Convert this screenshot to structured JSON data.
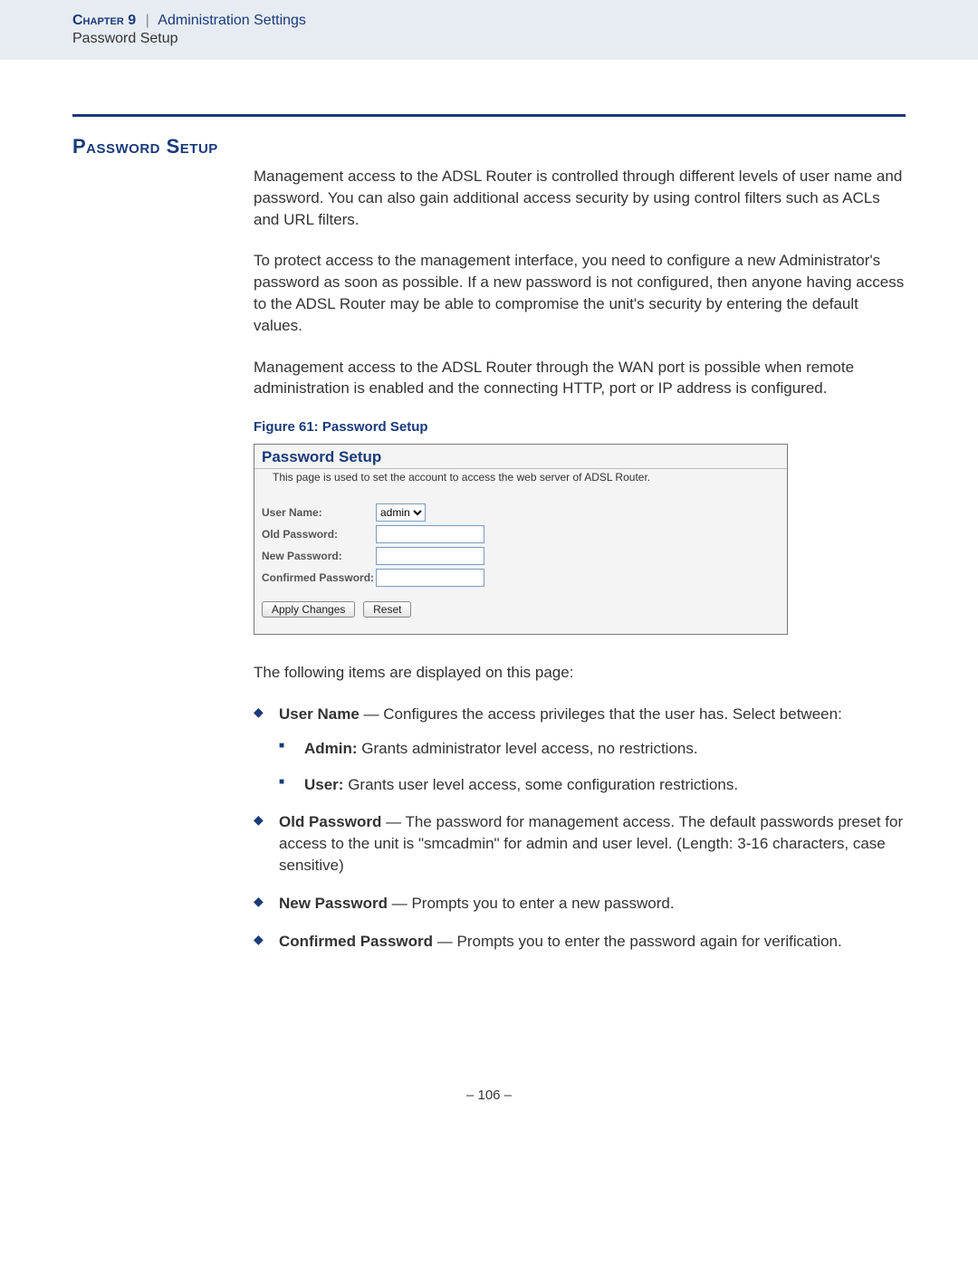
{
  "header": {
    "chapter_label": "Chapter 9",
    "pipe": "|",
    "section": "Administration Settings",
    "subsection": "Password Setup"
  },
  "title": "Password Setup",
  "paragraphs": {
    "p1": "Management access to the ADSL Router is controlled through different levels of user name and password. You can also gain additional access security by using control filters such as ACLs and URL filters.",
    "p2": "To protect access to the management interface, you need to configure a new Administrator's password as soon as possible. If a new password is not configured, then anyone having access to the ADSL Router may be able to compromise the unit's security by entering the default values.",
    "p3": "Management access to the ADSL Router through the WAN port is possible when remote administration is enabled and the connecting HTTP, port or IP address is configured.",
    "intro_items": "The following items are displayed on this page:"
  },
  "figure": {
    "caption": "Figure 61:  Password Setup",
    "panel_title": "Password Setup",
    "panel_desc": "This page is used to set the account to access the web server of ADSL Router.",
    "labels": {
      "user_name": "User Name:",
      "old_pw": "Old Password:",
      "new_pw": "New Password:",
      "conf_pw": "Confirmed Password:"
    },
    "user_name_value": "admin",
    "buttons": {
      "apply": "Apply Changes",
      "reset": "Reset"
    }
  },
  "items": {
    "username": {
      "bold": "User Name",
      "dash": " — ",
      "text": "Configures the access privileges that the user has. Select between:",
      "sub": {
        "admin": {
          "bold": "Admin:",
          "text": " Grants administrator level access, no restrictions."
        },
        "user": {
          "bold": "User:",
          "text": " Grants user level access, some configuration restrictions."
        }
      }
    },
    "oldpw": {
      "bold": "Old Password",
      "dash": " — ",
      "text": "The password for management access. The default passwords preset for access to the unit is \"smcadmin\" for admin and user level. (Length: 3-16 characters, case sensitive)"
    },
    "newpw": {
      "bold": "New Password",
      "dash": " — ",
      "text": "Prompts you to enter a new password."
    },
    "confpw": {
      "bold": "Confirmed Password",
      "dash": " — ",
      "text": "Prompts you to enter the password again for verification."
    }
  },
  "page_number": "–  106  –"
}
